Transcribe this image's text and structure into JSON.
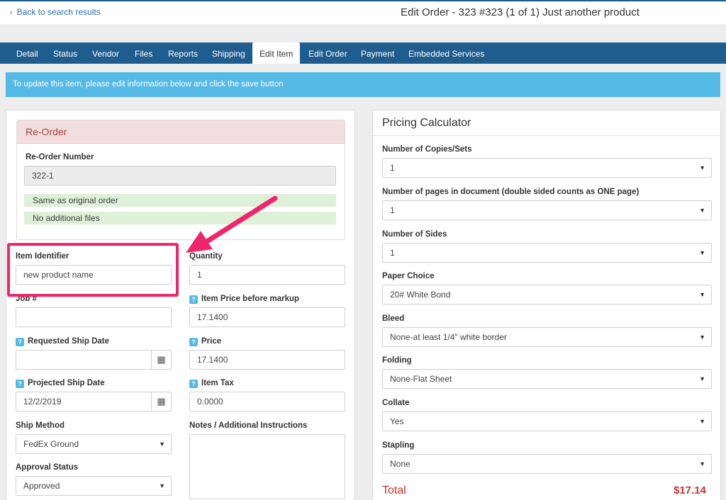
{
  "header": {
    "back_link": "Back to search results",
    "title": "Edit Order - 323 #323 (1 of 1) Just another product"
  },
  "tabs": [
    {
      "label": "Detail"
    },
    {
      "label": "Status"
    },
    {
      "label": "Vendor"
    },
    {
      "label": "Files"
    },
    {
      "label": "Reports"
    },
    {
      "label": "Shipping"
    },
    {
      "label": "Edit Item",
      "active": true
    },
    {
      "label": "Edit Order"
    },
    {
      "label": "Payment"
    },
    {
      "label": "Embedded Services"
    }
  ],
  "info_message": "To update this item, please edit information below and click the save button",
  "reorder": {
    "heading": "Re-Order",
    "number_label": "Re-Order Number",
    "number_value": "322-1",
    "note1": "Same as original order",
    "note2": "No additional files"
  },
  "form": {
    "item_identifier_label": "Item Identifier",
    "item_identifier_value": "new product name",
    "quantity_label": "Quantity",
    "quantity_value": "1",
    "job_label": "Job #",
    "job_value": "",
    "item_price_label": "Item Price before markup",
    "item_price_value": "17.1400",
    "requested_ship_label": "Requested Ship Date",
    "requested_ship_value": "",
    "price_label": "Price",
    "price_value": "17.1400",
    "projected_ship_label": "Projected Ship Date",
    "projected_ship_value": "12/2/2019",
    "item_tax_label": "Item Tax",
    "item_tax_value": "0.0000",
    "ship_method_label": "Ship Method",
    "ship_method_value": "FedEx Ground",
    "notes_label": "Notes / Additional Instructions",
    "notes_value": "",
    "approval_label": "Approval Status",
    "approval_value": "Approved"
  },
  "calculator": {
    "title": "Pricing Calculator",
    "fields": [
      {
        "label": "Number of Copies/Sets",
        "value": "1"
      },
      {
        "label": "Number of pages in document (double sided counts as ONE page)",
        "value": "1"
      },
      {
        "label": "Number of Sides",
        "value": "1"
      },
      {
        "label": "Paper Choice",
        "value": "20# White Bond"
      },
      {
        "label": "Bleed",
        "value": "None-at least 1/4\" white border"
      },
      {
        "label": "Folding",
        "value": "None-Flat Sheet"
      },
      {
        "label": "Collate",
        "value": "Yes"
      },
      {
        "label": "Stapling",
        "value": "None"
      }
    ],
    "total_label": "Total",
    "total_value": "$17.14"
  },
  "icons": {
    "help": "?",
    "caret": "▼",
    "calendar": "▦"
  },
  "colors": {
    "nav_bar": "#1f5d8f",
    "info_bar": "#55b9e6",
    "annotation": "#f0256b",
    "total": "#c9302c"
  }
}
